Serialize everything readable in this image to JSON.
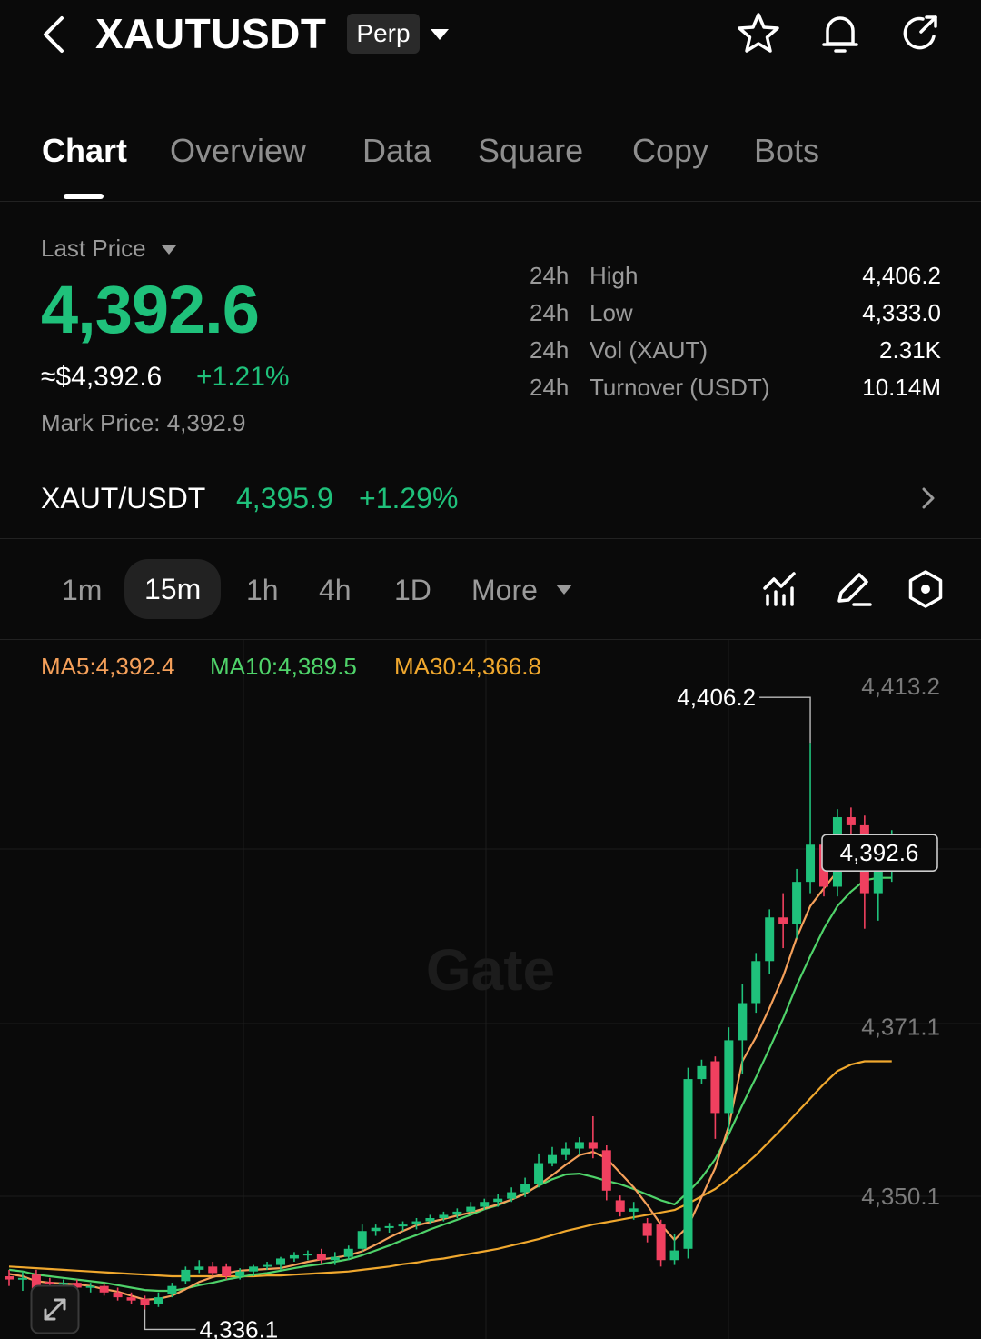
{
  "header": {
    "symbol": "XAUTUSDT",
    "contract_type": "Perp",
    "icons": [
      "back-arrow-icon",
      "star-icon",
      "bell-icon",
      "share-icon"
    ]
  },
  "tabs": [
    "Chart",
    "Overview",
    "Data",
    "Square",
    "Copy",
    "Bots"
  ],
  "active_tab": "Chart",
  "price": {
    "last_price_label": "Last Price",
    "last_price": "4,392.6",
    "approx": "≈$4,392.6",
    "change_pct": "+1.21%",
    "mark_price_label": "Mark Price:",
    "mark_price": "4,392.9"
  },
  "stats": [
    {
      "period": "24h",
      "name": "High",
      "value": "4,406.2"
    },
    {
      "period": "24h",
      "name": "Low",
      "value": "4,333.0"
    },
    {
      "period": "24h",
      "name": "Vol (XAUT)",
      "value": "2.31K"
    },
    {
      "period": "24h",
      "name": "Turnover (USDT)",
      "value": "10.14M"
    }
  ],
  "spot": {
    "pair": "XAUT/USDT",
    "price": "4,395.9",
    "change": "+1.29%"
  },
  "intervals": {
    "items": [
      "1m",
      "15m",
      "1h",
      "4h",
      "1D"
    ],
    "selected": "15m",
    "more": "More"
  },
  "ma": {
    "ma5": "MA5:4,392.4",
    "ma10": "MA10:4,389.5",
    "ma30": "MA30:4,366.8"
  },
  "colors": {
    "up": "#1fc17b",
    "down": "#f0405f",
    "ma5": "#f5a05a",
    "ma10": "#4fd36a",
    "ma30": "#f0a82e"
  },
  "watermark": "Gate",
  "chart_data": {
    "type": "candlestick",
    "interval": "15m",
    "y_ticks": [
      "4,413.2",
      "4,371.1",
      "4,350.1"
    ],
    "ylim": [
      4333.0,
      4418.0
    ],
    "high_marker": "4,406.2",
    "low_marker": "4,336.1",
    "current_price_tag": "4,392.6",
    "candles": [
      {
        "o": 4340.2,
        "h": 4341.0,
        "l": 4339.0,
        "c": 4339.8
      },
      {
        "o": 4339.8,
        "h": 4340.8,
        "l": 4338.4,
        "c": 4340.0
      },
      {
        "o": 4340.4,
        "h": 4341.0,
        "l": 4337.4,
        "c": 4338.2
      },
      {
        "o": 4339.5,
        "h": 4340.0,
        "l": 4338.6,
        "c": 4339.2
      },
      {
        "o": 4339.2,
        "h": 4339.8,
        "l": 4338.6,
        "c": 4339.4
      },
      {
        "o": 4339.4,
        "h": 4339.8,
        "l": 4338.4,
        "c": 4338.8
      },
      {
        "o": 4338.8,
        "h": 4339.4,
        "l": 4338.2,
        "c": 4339.0
      },
      {
        "o": 4339.0,
        "h": 4339.4,
        "l": 4337.8,
        "c": 4338.2
      },
      {
        "o": 4338.2,
        "h": 4338.8,
        "l": 4337.2,
        "c": 4337.6
      },
      {
        "o": 4337.6,
        "h": 4338.2,
        "l": 4336.8,
        "c": 4337.2
      },
      {
        "o": 4337.4,
        "h": 4337.8,
        "l": 4336.1,
        "c": 4336.6
      },
      {
        "o": 4336.8,
        "h": 4338.2,
        "l": 4336.4,
        "c": 4337.6
      },
      {
        "o": 4338.0,
        "h": 4339.4,
        "l": 4337.6,
        "c": 4339.0
      },
      {
        "o": 4339.6,
        "h": 4341.4,
        "l": 4339.2,
        "c": 4341.0
      },
      {
        "o": 4341.0,
        "h": 4342.2,
        "l": 4340.6,
        "c": 4341.4
      },
      {
        "o": 4341.4,
        "h": 4342.0,
        "l": 4340.2,
        "c": 4340.6
      },
      {
        "o": 4341.4,
        "h": 4341.8,
        "l": 4339.8,
        "c": 4340.2
      },
      {
        "o": 4340.2,
        "h": 4341.2,
        "l": 4339.8,
        "c": 4340.8
      },
      {
        "o": 4340.8,
        "h": 4341.6,
        "l": 4340.2,
        "c": 4341.4
      },
      {
        "o": 4341.4,
        "h": 4342.0,
        "l": 4341.0,
        "c": 4341.6
      },
      {
        "o": 4341.6,
        "h": 4342.6,
        "l": 4341.0,
        "c": 4342.4
      },
      {
        "o": 4342.4,
        "h": 4343.2,
        "l": 4342.0,
        "c": 4342.8
      },
      {
        "o": 4342.8,
        "h": 4343.4,
        "l": 4342.2,
        "c": 4343.0
      },
      {
        "o": 4343.0,
        "h": 4343.6,
        "l": 4341.8,
        "c": 4342.2
      },
      {
        "o": 4342.2,
        "h": 4343.2,
        "l": 4341.6,
        "c": 4342.6
      },
      {
        "o": 4342.6,
        "h": 4344.0,
        "l": 4342.2,
        "c": 4343.6
      },
      {
        "o": 4343.6,
        "h": 4346.6,
        "l": 4343.2,
        "c": 4345.8
      },
      {
        "o": 4345.8,
        "h": 4346.6,
        "l": 4345.2,
        "c": 4346.2
      },
      {
        "o": 4346.2,
        "h": 4346.8,
        "l": 4345.6,
        "c": 4346.4
      },
      {
        "o": 4346.4,
        "h": 4347.0,
        "l": 4345.8,
        "c": 4346.6
      },
      {
        "o": 4346.6,
        "h": 4347.4,
        "l": 4346.0,
        "c": 4347.0
      },
      {
        "o": 4347.0,
        "h": 4347.8,
        "l": 4346.6,
        "c": 4347.4
      },
      {
        "o": 4347.4,
        "h": 4348.2,
        "l": 4347.0,
        "c": 4347.8
      },
      {
        "o": 4347.8,
        "h": 4348.6,
        "l": 4347.4,
        "c": 4348.2
      },
      {
        "o": 4348.2,
        "h": 4349.4,
        "l": 4347.8,
        "c": 4348.8
      },
      {
        "o": 4348.8,
        "h": 4349.8,
        "l": 4348.4,
        "c": 4349.4
      },
      {
        "o": 4349.4,
        "h": 4350.4,
        "l": 4348.8,
        "c": 4349.8
      },
      {
        "o": 4349.8,
        "h": 4351.2,
        "l": 4349.4,
        "c": 4350.6
      },
      {
        "o": 4350.6,
        "h": 4352.4,
        "l": 4350.0,
        "c": 4351.6
      },
      {
        "o": 4351.6,
        "h": 4355.4,
        "l": 4351.2,
        "c": 4354.2
      },
      {
        "o": 4354.2,
        "h": 4356.2,
        "l": 4353.8,
        "c": 4355.2
      },
      {
        "o": 4355.2,
        "h": 4356.8,
        "l": 4354.6,
        "c": 4356.0
      },
      {
        "o": 4356.0,
        "h": 4357.4,
        "l": 4355.2,
        "c": 4356.8
      },
      {
        "o": 4356.8,
        "h": 4360.0,
        "l": 4354.8,
        "c": 4356.0
      },
      {
        "o": 4355.8,
        "h": 4356.4,
        "l": 4349.6,
        "c": 4350.8
      },
      {
        "o": 4349.6,
        "h": 4350.2,
        "l": 4347.6,
        "c": 4348.2
      },
      {
        "o": 4348.2,
        "h": 4349.4,
        "l": 4347.2,
        "c": 4348.6
      },
      {
        "o": 4346.8,
        "h": 4347.4,
        "l": 4344.4,
        "c": 4345.2
      },
      {
        "o": 4346.6,
        "h": 4347.2,
        "l": 4341.4,
        "c": 4342.2
      },
      {
        "o": 4342.2,
        "h": 4345.4,
        "l": 4341.6,
        "c": 4343.4
      },
      {
        "o": 4343.6,
        "h": 4366.0,
        "l": 4342.4,
        "c": 4364.6
      },
      {
        "o": 4364.6,
        "h": 4367.0,
        "l": 4364.0,
        "c": 4366.2
      },
      {
        "o": 4366.8,
        "h": 4367.4,
        "l": 4357.2,
        "c": 4360.4
      },
      {
        "o": 4360.4,
        "h": 4371.0,
        "l": 4358.2,
        "c": 4369.4
      },
      {
        "o": 4369.4,
        "h": 4376.4,
        "l": 4365.2,
        "c": 4374.0
      },
      {
        "o": 4374.0,
        "h": 4380.2,
        "l": 4372.8,
        "c": 4379.2
      },
      {
        "o": 4379.2,
        "h": 4385.6,
        "l": 4377.6,
        "c": 4384.6
      },
      {
        "o": 4384.6,
        "h": 4387.6,
        "l": 4380.8,
        "c": 4383.8
      },
      {
        "o": 4383.8,
        "h": 4390.6,
        "l": 4382.0,
        "c": 4389.0
      },
      {
        "o": 4389.0,
        "h": 4406.2,
        "l": 4387.6,
        "c": 4393.6
      },
      {
        "o": 4393.6,
        "h": 4394.6,
        "l": 4387.2,
        "c": 4388.4
      },
      {
        "o": 4388.4,
        "h": 4398.0,
        "l": 4387.2,
        "c": 4397.0
      },
      {
        "o": 4397.0,
        "h": 4398.2,
        "l": 4393.2,
        "c": 4396.0
      },
      {
        "o": 4396.0,
        "h": 4397.2,
        "l": 4383.2,
        "c": 4387.6
      },
      {
        "o": 4387.6,
        "h": 4393.4,
        "l": 4384.2,
        "c": 4391.6
      },
      {
        "o": 4391.6,
        "h": 4395.4,
        "l": 4389.0,
        "c": 4392.6
      }
    ],
    "ma5": [
      4340.5,
      4340.2,
      4339.6,
      4339.4,
      4339.3,
      4339.2,
      4339.0,
      4338.6,
      4338.3,
      4337.8,
      4337.3,
      4337.4,
      4337.8,
      4338.6,
      4339.5,
      4340.1,
      4340.6,
      4340.9,
      4341.0,
      4341.1,
      4341.2,
      4341.6,
      4342.0,
      4342.3,
      4342.5,
      4342.8,
      4343.3,
      4344.1,
      4345.0,
      4345.8,
      4346.5,
      4346.9,
      4347.3,
      4347.7,
      4348.1,
      4348.6,
      4349.1,
      4349.7,
      4350.4,
      4351.5,
      4352.7,
      4354.0,
      4355.2,
      4355.6,
      4354.8,
      4353.0,
      4351.2,
      4349.0,
      4346.6,
      4344.7,
      4346.4,
      4350.0,
      4353.6,
      4358.8,
      4366.8,
      4369.8,
      4373.4,
      4377.3,
      4382.1,
      4386.0,
      4388.2,
      4390.3,
      4391.2,
      4392.4,
      4392.4,
      4392.4
    ],
    "ma10": [
      4341.0,
      4340.8,
      4340.4,
      4340.2,
      4340.0,
      4339.8,
      4339.6,
      4339.4,
      4339.1,
      4338.8,
      4338.5,
      4338.4,
      4338.4,
      4338.7,
      4339.1,
      4339.4,
      4339.8,
      4340.1,
      4340.4,
      4340.6,
      4340.9,
      4341.2,
      4341.5,
      4341.7,
      4342.0,
      4342.3,
      4342.8,
      4343.4,
      4344.0,
      4344.7,
      4345.3,
      4346.0,
      4346.6,
      4347.2,
      4347.8,
      4348.5,
      4349.0,
      4349.7,
      4350.5,
      4351.4,
      4352.2,
      4352.8,
      4352.9,
      4352.5,
      4352.0,
      4351.6,
      4351.0,
      4350.3,
      4349.6,
      4349.1,
      4350.6,
      4352.4,
      4354.7,
      4357.8,
      4361.4,
      4364.8,
      4368.4,
      4372.1,
      4376.2,
      4379.8,
      4383.2,
      4386.0,
      4387.8,
      4389.2,
      4389.5,
      4389.5
    ],
    "ma30": [
      4341.4,
      4341.3,
      4341.2,
      4341.1,
      4341.0,
      4340.9,
      4340.8,
      4340.7,
      4340.6,
      4340.5,
      4340.4,
      4340.3,
      4340.2,
      4340.2,
      4340.2,
      4340.2,
      4340.2,
      4340.2,
      4340.2,
      4340.3,
      4340.3,
      4340.4,
      4340.5,
      4340.6,
      4340.7,
      4340.8,
      4341.0,
      4341.2,
      4341.4,
      4341.7,
      4341.9,
      4342.2,
      4342.4,
      4342.7,
      4343.0,
      4343.3,
      4343.6,
      4344.0,
      4344.4,
      4344.8,
      4345.3,
      4345.8,
      4346.2,
      4346.6,
      4346.9,
      4347.2,
      4347.5,
      4347.8,
      4348.1,
      4348.4,
      4349.2,
      4350.1,
      4351.0,
      4352.3,
      4353.7,
      4355.2,
      4356.9,
      4358.6,
      4360.4,
      4362.2,
      4364.0,
      4365.6,
      4366.4,
      4366.8,
      4366.8,
      4366.8
    ]
  }
}
